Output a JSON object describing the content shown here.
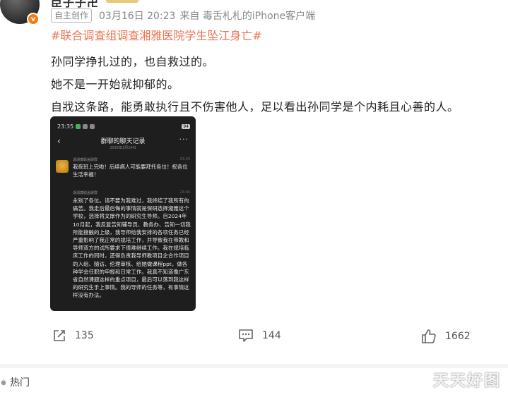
{
  "header": {
    "username": "臣子子卍",
    "badge": "v",
    "tag": "自主创作",
    "date": "03月16日 20:23",
    "source": "来自 毒舌札札的iPhone客户端"
  },
  "post": {
    "hashtag": "#联合调查组调查湘雅医院学生坠江身亡#",
    "lines": [
      "孙同学挣扎过的，也自救过的。",
      "她不是一开始就抑郁的。",
      "自戕这条路，能勇敢执行且不伤害他人，足以看出孙同学是个内耗且心善的人。"
    ]
  },
  "phone": {
    "status_time": "23:35",
    "battery": "94",
    "back": "‹",
    "title": "群聊的聊天记录",
    "subtitle": "2026年3月14日",
    "more": "···",
    "msg1_name": "湖湖廉聪盖聊群",
    "msg1_time": "23:03",
    "msg1_text": "我夜班上完啦！后续病人可能要拜托各位！祝各位生活幸福！",
    "msg2_name": "湖湖廉聪盖聊群",
    "msg2_time": "23:04",
    "msg2_text": "永别了各位。请不要为我难过，我终结了我所有的痛苦。我走后最后悔的事情就是保研选择湘雅这个学校，选择将文厚作为的研究生导师。自2024年10月起，我反复告知辅导员、教务办、告知一切我所能接触的上级，我导师给我安排的各项任务已经严重影响了我正常的规培工作，并导致我在带教和导师双方的试所要求下很难继续工作。我在规培临床工作的同时，还得负责我导师教项目企合作项目的入组、随访、伦理审核、给她做课程ppt，做各种学会任职的申报和日常工作。我真不知道像广东省自然课题这样的重点项目，最后可以落到我这样的研究生手上事情。我的导师的任务等，有事情这样没有办法。"
  },
  "actions": {
    "share_count": "135",
    "comment_count": "144",
    "like_count": "1662"
  },
  "footer": {
    "hot_label": "热门"
  },
  "watermark": "天天好图",
  "colors": {
    "hashtag": "#eb7350",
    "badge": "#f57c12"
  }
}
